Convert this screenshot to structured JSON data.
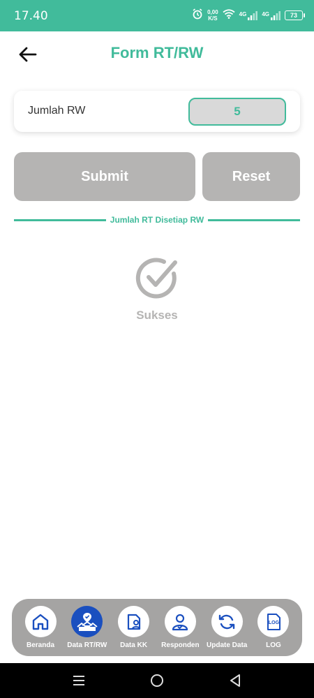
{
  "status_bar": {
    "time": "17.40",
    "net_speed_value": "0,00",
    "net_speed_unit": "K/S",
    "signal1_label": "4G",
    "signal2_label": "4G",
    "battery": "73"
  },
  "header": {
    "title": "Form RT/RW"
  },
  "form": {
    "rw_label": "Jumlah RW",
    "rw_value": "5",
    "submit_label": "Submit",
    "reset_label": "Reset"
  },
  "section": {
    "divider_text": "Jumlah RT Disetiap RW"
  },
  "result": {
    "status_text": "Sukses"
  },
  "bottom_nav": {
    "items": [
      {
        "label": "Beranda"
      },
      {
        "label": "Data RT/RW"
      },
      {
        "label": "Data KK"
      },
      {
        "label": "Responden"
      },
      {
        "label": "Update Data"
      },
      {
        "label": "LOG",
        "icon_text": "LOG"
      }
    ]
  },
  "colors": {
    "accent": "#41bb9b",
    "button_gray": "#b5b4b3",
    "nav_bg": "#a5a4a3",
    "nav_active": "#1a4fbf",
    "icon_blue": "#1a4fbf"
  }
}
